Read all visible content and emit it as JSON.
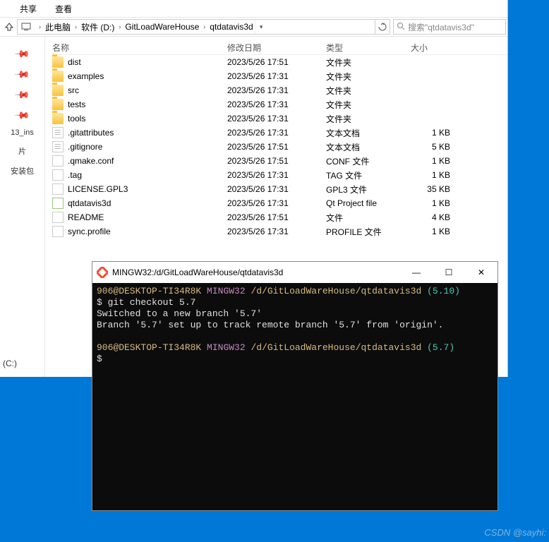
{
  "menubar": {
    "share": "共享",
    "view": "查看"
  },
  "breadcrumbs": [
    "此电脑",
    "软件 (D:)",
    "GitLoadWareHouse",
    "qtdatavis3d"
  ],
  "search_placeholder": "搜索\"qtdatavis3d\"",
  "columns": {
    "name": "名称",
    "date": "修改日期",
    "type": "类型",
    "size": "大小"
  },
  "sidebar_items": [
    "13_ins",
    "片",
    "安装包"
  ],
  "drive_left": "(C:)",
  "files": [
    {
      "icon": "folder",
      "name": "dist",
      "date": "2023/5/26 17:51",
      "type": "文件夹",
      "size": ""
    },
    {
      "icon": "folder",
      "name": "examples",
      "date": "2023/5/26 17:31",
      "type": "文件夹",
      "size": ""
    },
    {
      "icon": "folder",
      "name": "src",
      "date": "2023/5/26 17:31",
      "type": "文件夹",
      "size": ""
    },
    {
      "icon": "folder",
      "name": "tests",
      "date": "2023/5/26 17:31",
      "type": "文件夹",
      "size": ""
    },
    {
      "icon": "folder",
      "name": "tools",
      "date": "2023/5/26 17:31",
      "type": "文件夹",
      "size": ""
    },
    {
      "icon": "text",
      "name": ".gitattributes",
      "date": "2023/5/26 17:31",
      "type": "文本文档",
      "size": "1 KB"
    },
    {
      "icon": "text",
      "name": ".gitignore",
      "date": "2023/5/26 17:51",
      "type": "文本文档",
      "size": "5 KB"
    },
    {
      "icon": "file",
      "name": ".qmake.conf",
      "date": "2023/5/26 17:51",
      "type": "CONF 文件",
      "size": "1 KB"
    },
    {
      "icon": "file",
      "name": ".tag",
      "date": "2023/5/26 17:31",
      "type": "TAG 文件",
      "size": "1 KB"
    },
    {
      "icon": "file",
      "name": "LICENSE.GPL3",
      "date": "2023/5/26 17:31",
      "type": "GPL3 文件",
      "size": "35 KB"
    },
    {
      "icon": "pro",
      "name": "qtdatavis3d",
      "date": "2023/5/26 17:31",
      "type": "Qt Project file",
      "size": "1 KB"
    },
    {
      "icon": "file",
      "name": "README",
      "date": "2023/5/26 17:51",
      "type": "文件",
      "size": "4 KB"
    },
    {
      "icon": "file",
      "name": "sync.profile",
      "date": "2023/5/26 17:31",
      "type": "PROFILE 文件",
      "size": "1 KB"
    }
  ],
  "terminal": {
    "title": "MINGW32:/d/GitLoadWareHouse/qtdatavis3d",
    "prompt1_user": "906@DESKTOP-TI34R8K",
    "prompt1_env": "MINGW32",
    "prompt1_path": "/d/GitLoadWareHouse/qtdatavis3d",
    "prompt1_branch": "(5.10)",
    "cmd": "$ git checkout 5.7",
    "out1": "Switched to a new branch '5.7'",
    "out2": "Branch '5.7' set up to track remote branch '5.7' from 'origin'.",
    "prompt2_branch": "(5.7)",
    "last": "$"
  },
  "watermark": "CSDN @sayhi:"
}
